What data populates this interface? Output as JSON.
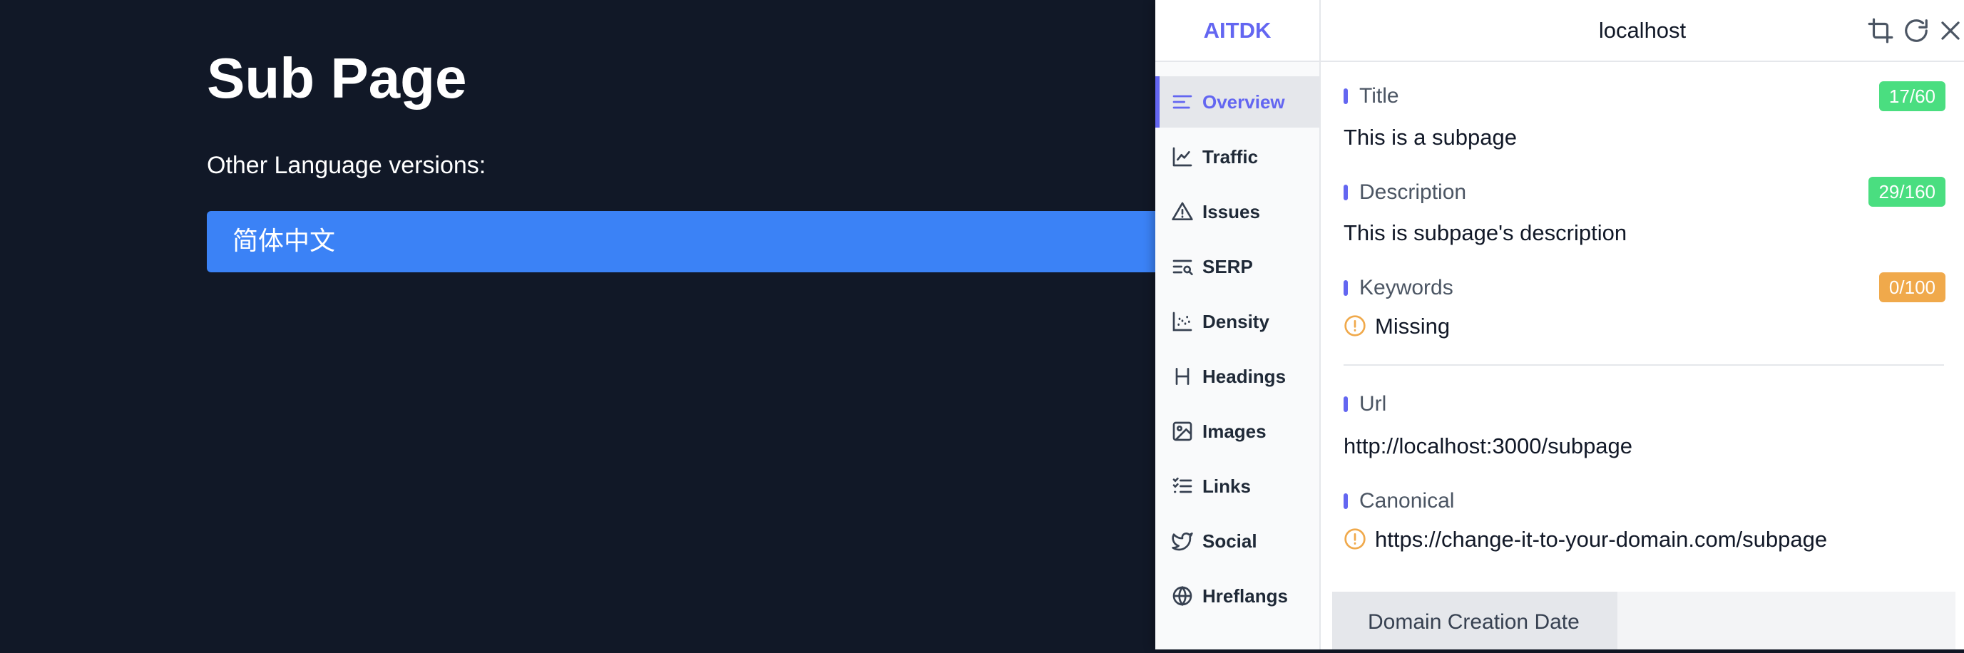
{
  "page": {
    "title": "Sub Page",
    "languages_label": "Other Language versions:",
    "language_link": "简体中文"
  },
  "panel": {
    "brand": "AITDK",
    "host": "localhost",
    "header_icons": [
      "crop-icon",
      "refresh-icon",
      "close-icon"
    ],
    "accent_color": "#6366f1",
    "nav": [
      {
        "label": "Overview",
        "icon": "overview-icon",
        "active": true
      },
      {
        "label": "Traffic",
        "icon": "chart-line-icon"
      },
      {
        "label": "Issues",
        "icon": "warning-triangle-icon"
      },
      {
        "label": "SERP",
        "icon": "serp-search-icon"
      },
      {
        "label": "Density",
        "icon": "scatter-icon"
      },
      {
        "label": "Headings",
        "icon": "heading-icon"
      },
      {
        "label": "Images",
        "icon": "image-icon"
      },
      {
        "label": "Links",
        "icon": "list-icon"
      },
      {
        "label": "Social",
        "icon": "twitter-icon"
      },
      {
        "label": "Hreflangs",
        "icon": "globe-icon"
      }
    ],
    "overview": {
      "title_label": "Title",
      "title_value": "This is a subpage",
      "title_count": "17/60",
      "description_label": "Description",
      "description_value": "This is subpage's description",
      "description_count": "29/160",
      "keywords_label": "Keywords",
      "keywords_value": "Missing",
      "keywords_count": "0/100",
      "url_label": "Url",
      "url_value": "http://localhost:3000/subpage",
      "canonical_label": "Canonical",
      "canonical_value": "https://change-it-to-your-domain.com/subpage",
      "domain_creation_label": "Domain Creation Date"
    },
    "colors": {
      "ok": "#4ade80",
      "warn": "#f0a94b"
    }
  }
}
